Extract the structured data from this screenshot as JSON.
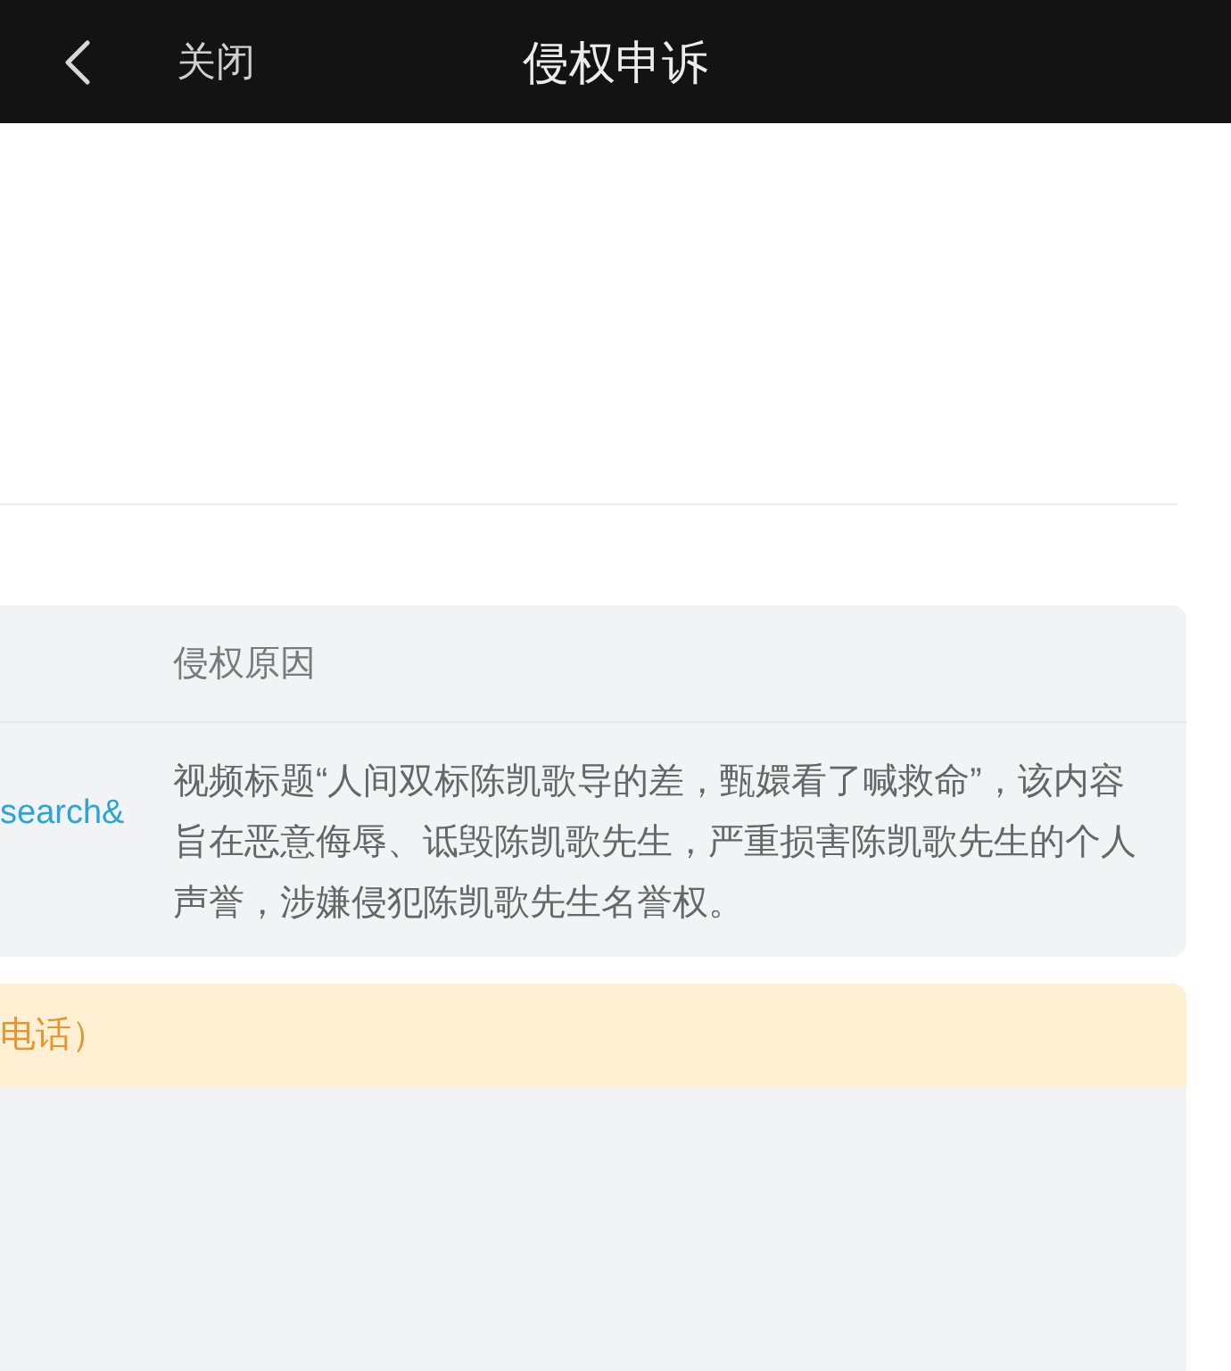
{
  "header": {
    "close_label": "关闭",
    "title": "侵权申诉"
  },
  "table": {
    "column_2_header": "侵权原因",
    "rows": [
      {
        "column_1": "search&",
        "column_2": "视频标题“人间双标陈凯歌导的差，甄嬛看了喊救命”，该内容旨在恶意侮辱、诋毁陈凯歌先生，严重损害陈凯歌先生的个人声誉，涉嫌侵犯陈凯歌先生名誉权。"
      }
    ]
  },
  "notice": {
    "text": "电话）"
  }
}
